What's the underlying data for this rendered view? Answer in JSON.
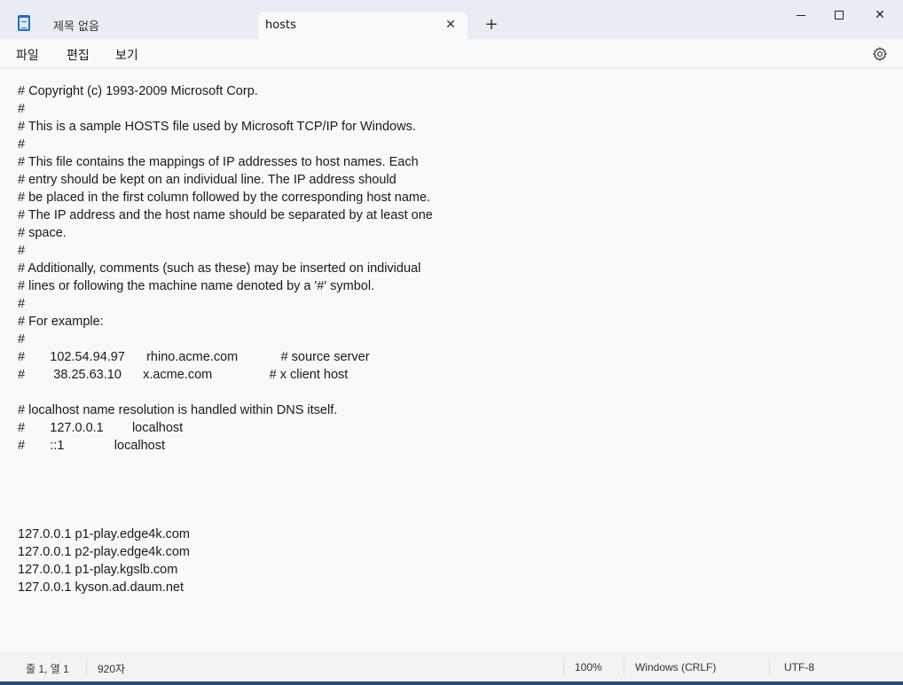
{
  "window": {
    "tabs": [
      {
        "label": "제목 없음"
      },
      {
        "label": "hosts"
      }
    ],
    "tab_close_glyph": "✕",
    "new_tab_glyph": "+",
    "close_glyph": "✕"
  },
  "menu": {
    "file": "파일",
    "edit": "편집",
    "view": "보기"
  },
  "document": {
    "lines": [
      "# Copyright (c) 1993-2009 Microsoft Corp.",
      "#",
      "# This is a sample HOSTS file used by Microsoft TCP/IP for Windows.",
      "#",
      "# This file contains the mappings of IP addresses to host names. Each",
      "# entry should be kept on an individual line. The IP address should",
      "# be placed in the first column followed by the corresponding host name.",
      "# The IP address and the host name should be separated by at least one",
      "# space.",
      "#",
      "# Additionally, comments (such as these) may be inserted on individual",
      "# lines or following the machine name denoted by a '#' symbol.",
      "#",
      "# For example:",
      "#",
      "#       102.54.94.97      rhino.acme.com            # source server",
      "#        38.25.63.10      x.acme.com                # x client host",
      "",
      "# localhost name resolution is handled within DNS itself.",
      "#       127.0.0.1        localhost",
      "#       ::1              localhost",
      "",
      "",
      "",
      "",
      "127.0.0.1 p1-play.edge4k.com",
      "127.0.0.1 p2-play.edge4k.com",
      "127.0.0.1 p1-play.kgslb.com",
      "127.0.0.1 kyson.ad.daum.net"
    ]
  },
  "status": {
    "position": "줄 1, 열 1",
    "chars": "920자",
    "zoom": "100%",
    "line_ending": "Windows (CRLF)",
    "encoding": "UTF-8"
  },
  "icons": {
    "app": "notepad-icon",
    "settings": "gear-icon",
    "minimize": "minimize-icon",
    "maximize": "maximize-icon",
    "close": "close-icon"
  },
  "colors": {
    "titlebar": "#e8edf4",
    "background": "#f9f9f9",
    "statusbar": "#f3f3f3"
  }
}
